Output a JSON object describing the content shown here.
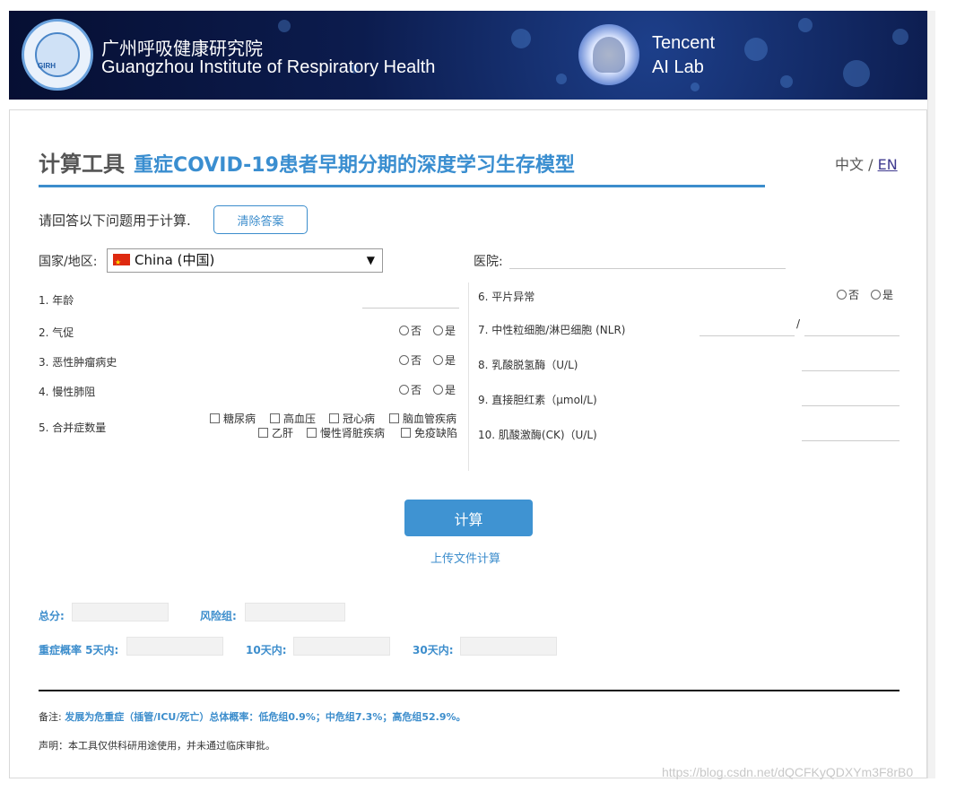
{
  "header": {
    "org_cn": "广州呼吸健康研究院",
    "org_en": "Guangzhou Institute of Respiratory Health",
    "logo_text": "GIRH",
    "partner_line1": "Tencent",
    "partner_line2": "AI Lab"
  },
  "title": {
    "main": "计算工具",
    "sub": "重症COVID-19患者早期分期的深度学习生存模型"
  },
  "lang": {
    "zh": "中文 / ",
    "en": "EN"
  },
  "prompt": "请回答以下问题用于计算.",
  "clear_button": "清除答案",
  "country": {
    "label": "国家/地区:",
    "selected": "China (中国)",
    "arrow": "▼"
  },
  "hospital": {
    "label": "医院:"
  },
  "questions_left": [
    {
      "label": "1. 年龄"
    },
    {
      "label": "2. 气促",
      "opt_no": "否",
      "opt_yes": "是"
    },
    {
      "label": "3. 恶性肿瘤病史",
      "opt_no": "否",
      "opt_yes": "是"
    },
    {
      "label": "4. 慢性肺阻",
      "opt_no": "否",
      "opt_yes": "是"
    },
    {
      "label": "5. 合并症数量"
    }
  ],
  "comorbidities": [
    "糖尿病",
    "高血压",
    "冠心病",
    "脑血管疾病",
    "乙肝",
    "慢性肾脏疾病",
    "免疫缺陷"
  ],
  "questions_right": [
    {
      "label": "6. 平片异常",
      "opt_no": "否",
      "opt_yes": "是"
    },
    {
      "label": "7. 中性粒细胞/淋巴细胞 (NLR)",
      "separator": "/"
    },
    {
      "label": "8. 乳酸脱氢酶（U/L)"
    },
    {
      "label": "9. 直接胆红素（μmol/L)"
    },
    {
      "label": "10. 肌酸激酶(CK)（U/L)"
    }
  ],
  "calc_button": "计算",
  "upload_link": "上传文件计算",
  "results": {
    "total_label": "总分:",
    "risk_label": "风险组:",
    "prob5_label": "重症概率 5天内:",
    "prob10_label": "10天内:",
    "prob30_label": "30天内:"
  },
  "note": {
    "prefix": "备注: ",
    "text": "发展为危重症（插管/ICU/死亡）总体概率：低危组0.9%；中危组7.3%；高危组52.9%。"
  },
  "statement": "声明：本工具仅供科研用途使用，并未通过临床审批。",
  "watermark": "https://blog.csdn.net/dQCFKyQDXYm3F8rB0",
  "colors": {
    "accent": "#3c8dcc",
    "banner": "#0c1c4e",
    "button": "#3f93d2"
  }
}
